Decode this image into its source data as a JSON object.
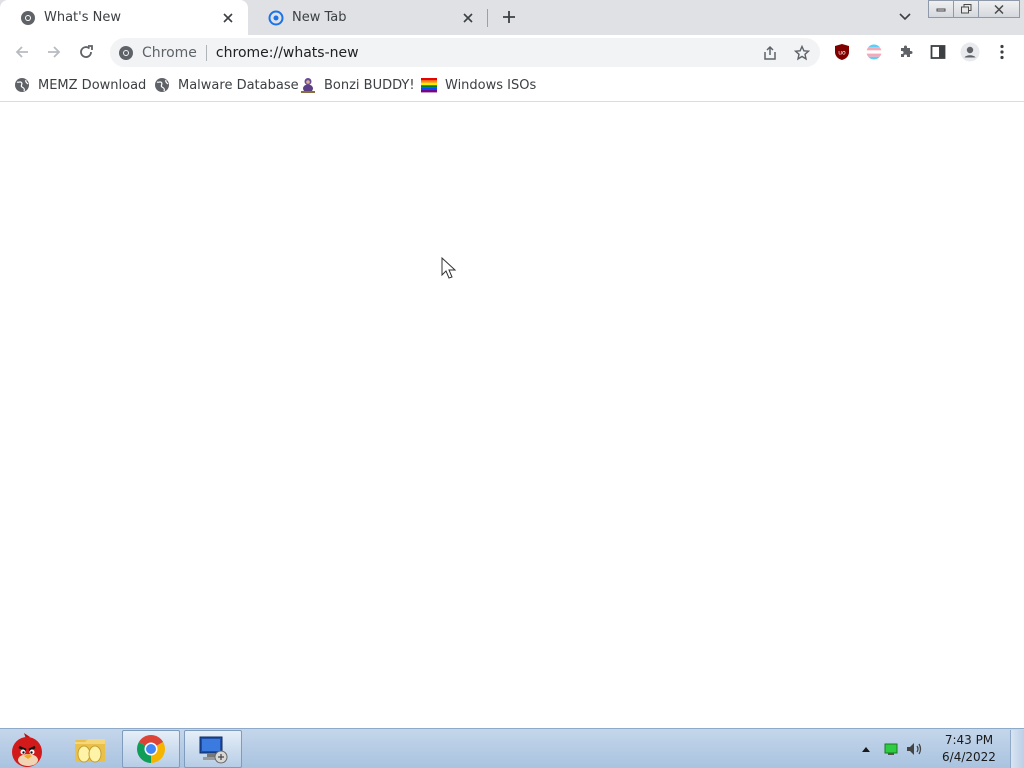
{
  "tabs": [
    {
      "title": "What's New",
      "icon": "chrome-icon",
      "active": true
    },
    {
      "title": "New Tab",
      "icon": "new-tab-icon",
      "active": false
    }
  ],
  "toolbar": {
    "site_chip": "Chrome",
    "url": "chrome://whats-new"
  },
  "bookmarks": [
    {
      "label": "MEMZ Download",
      "icon": "globe-icon"
    },
    {
      "label": "Malware Database",
      "icon": "globe-icon"
    },
    {
      "label": "Bonzi BUDDY!",
      "icon": "bonzi-icon"
    },
    {
      "label": "Windows ISOs",
      "icon": "rainbow-flag-icon"
    }
  ],
  "taskbar": {
    "clock_time": "7:43 PM",
    "clock_date": "6/4/2022",
    "pinned": [
      "angry-bird-start-icon",
      "folder-icon",
      "chrome-icon",
      "network-monitor-icon"
    ]
  },
  "colors": {
    "tabstrip": "#dfe1e5",
    "omnibox": "#f1f3f4",
    "text": "#3c4043",
    "taskbar": "#b7cde6"
  }
}
